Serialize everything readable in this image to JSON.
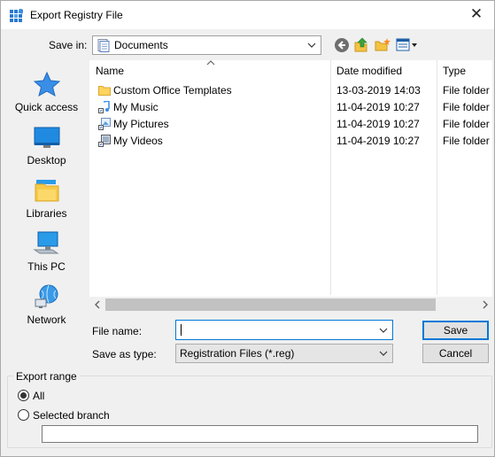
{
  "window": {
    "title": "Export Registry File",
    "close_glyph": "✕"
  },
  "save_in": {
    "label": "Save in:",
    "value": "Documents"
  },
  "toolbar": {
    "icons": [
      "back-icon",
      "up-folder-icon",
      "new-folder-icon",
      "view-menu-icon"
    ]
  },
  "places": [
    {
      "label": "Quick access",
      "icon": "star-icon"
    },
    {
      "label": "Desktop",
      "icon": "desktop-icon"
    },
    {
      "label": "Libraries",
      "icon": "libraries-icon"
    },
    {
      "label": "This PC",
      "icon": "computer-icon"
    },
    {
      "label": "Network",
      "icon": "network-icon"
    }
  ],
  "file_list": {
    "columns": [
      "Name",
      "Date modified",
      "Type"
    ],
    "rows": [
      {
        "name": "Custom Office Templates",
        "date": "13-03-2019 14:03",
        "type": "File folder",
        "icon": "folder-icon"
      },
      {
        "name": "My Music",
        "date": "11-04-2019 10:27",
        "type": "File folder",
        "icon": "music-shortcut-icon"
      },
      {
        "name": "My Pictures",
        "date": "11-04-2019 10:27",
        "type": "File folder",
        "icon": "pictures-shortcut-icon"
      },
      {
        "name": "My Videos",
        "date": "11-04-2019 10:27",
        "type": "File folder",
        "icon": "videos-shortcut-icon"
      }
    ]
  },
  "file_name": {
    "label": "File name:",
    "value": ""
  },
  "save_as_type": {
    "label": "Save as type:",
    "value": "Registration Files (*.reg)"
  },
  "buttons": {
    "save": "Save",
    "cancel": "Cancel"
  },
  "export_range": {
    "title": "Export range",
    "options": [
      {
        "label": "All",
        "selected": true
      },
      {
        "label": "Selected branch",
        "selected": false
      }
    ],
    "branch_value": ""
  },
  "colors": {
    "accent": "#0078d7",
    "folder": "#ffd35c"
  }
}
